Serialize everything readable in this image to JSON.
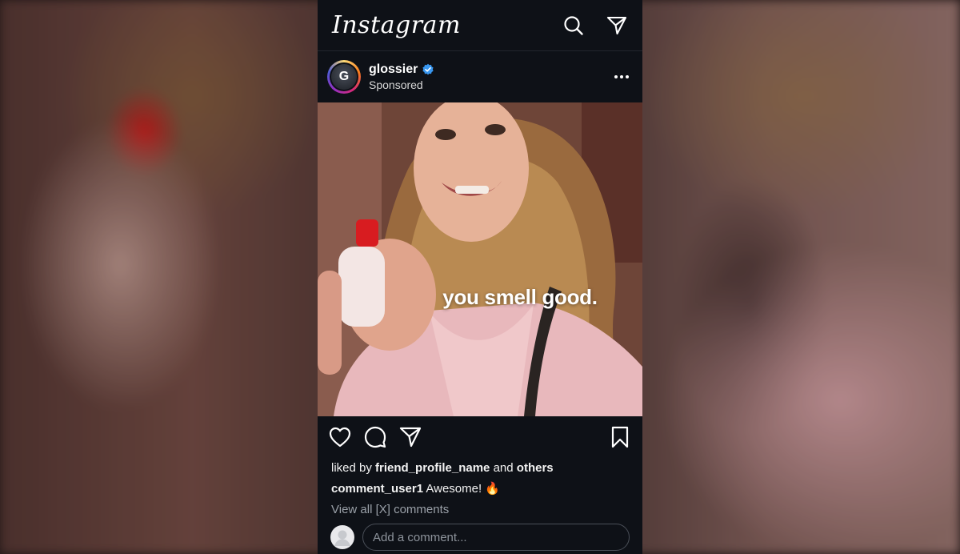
{
  "app": {
    "logo_text": "Instagram"
  },
  "topbar": {
    "icons": [
      "search-icon",
      "direct-message-icon"
    ]
  },
  "post": {
    "author": {
      "name": "glossier",
      "verified": true,
      "sponsored_label": "Sponsored",
      "avatar_letter": "G"
    },
    "media": {
      "overlay_text": "you smell good."
    },
    "actions": {
      "icons": [
        "heart-icon",
        "comment-icon",
        "share-icon",
        "bookmark-icon"
      ]
    },
    "likes": {
      "prefix": "liked by ",
      "friend": "friend_profile_name",
      "conjunction": " and ",
      "others": "others"
    },
    "comment": {
      "user": "comment_user1",
      "text": " Awesome! 🔥"
    },
    "view_all_comments": "View all [X] comments",
    "add_comment": {
      "placeholder": "Add a comment..."
    }
  },
  "colors": {
    "background": "#0e1117",
    "verified_blue": "#3897f0",
    "text": "#f2f2f2",
    "muted": "#9aa0a8"
  }
}
